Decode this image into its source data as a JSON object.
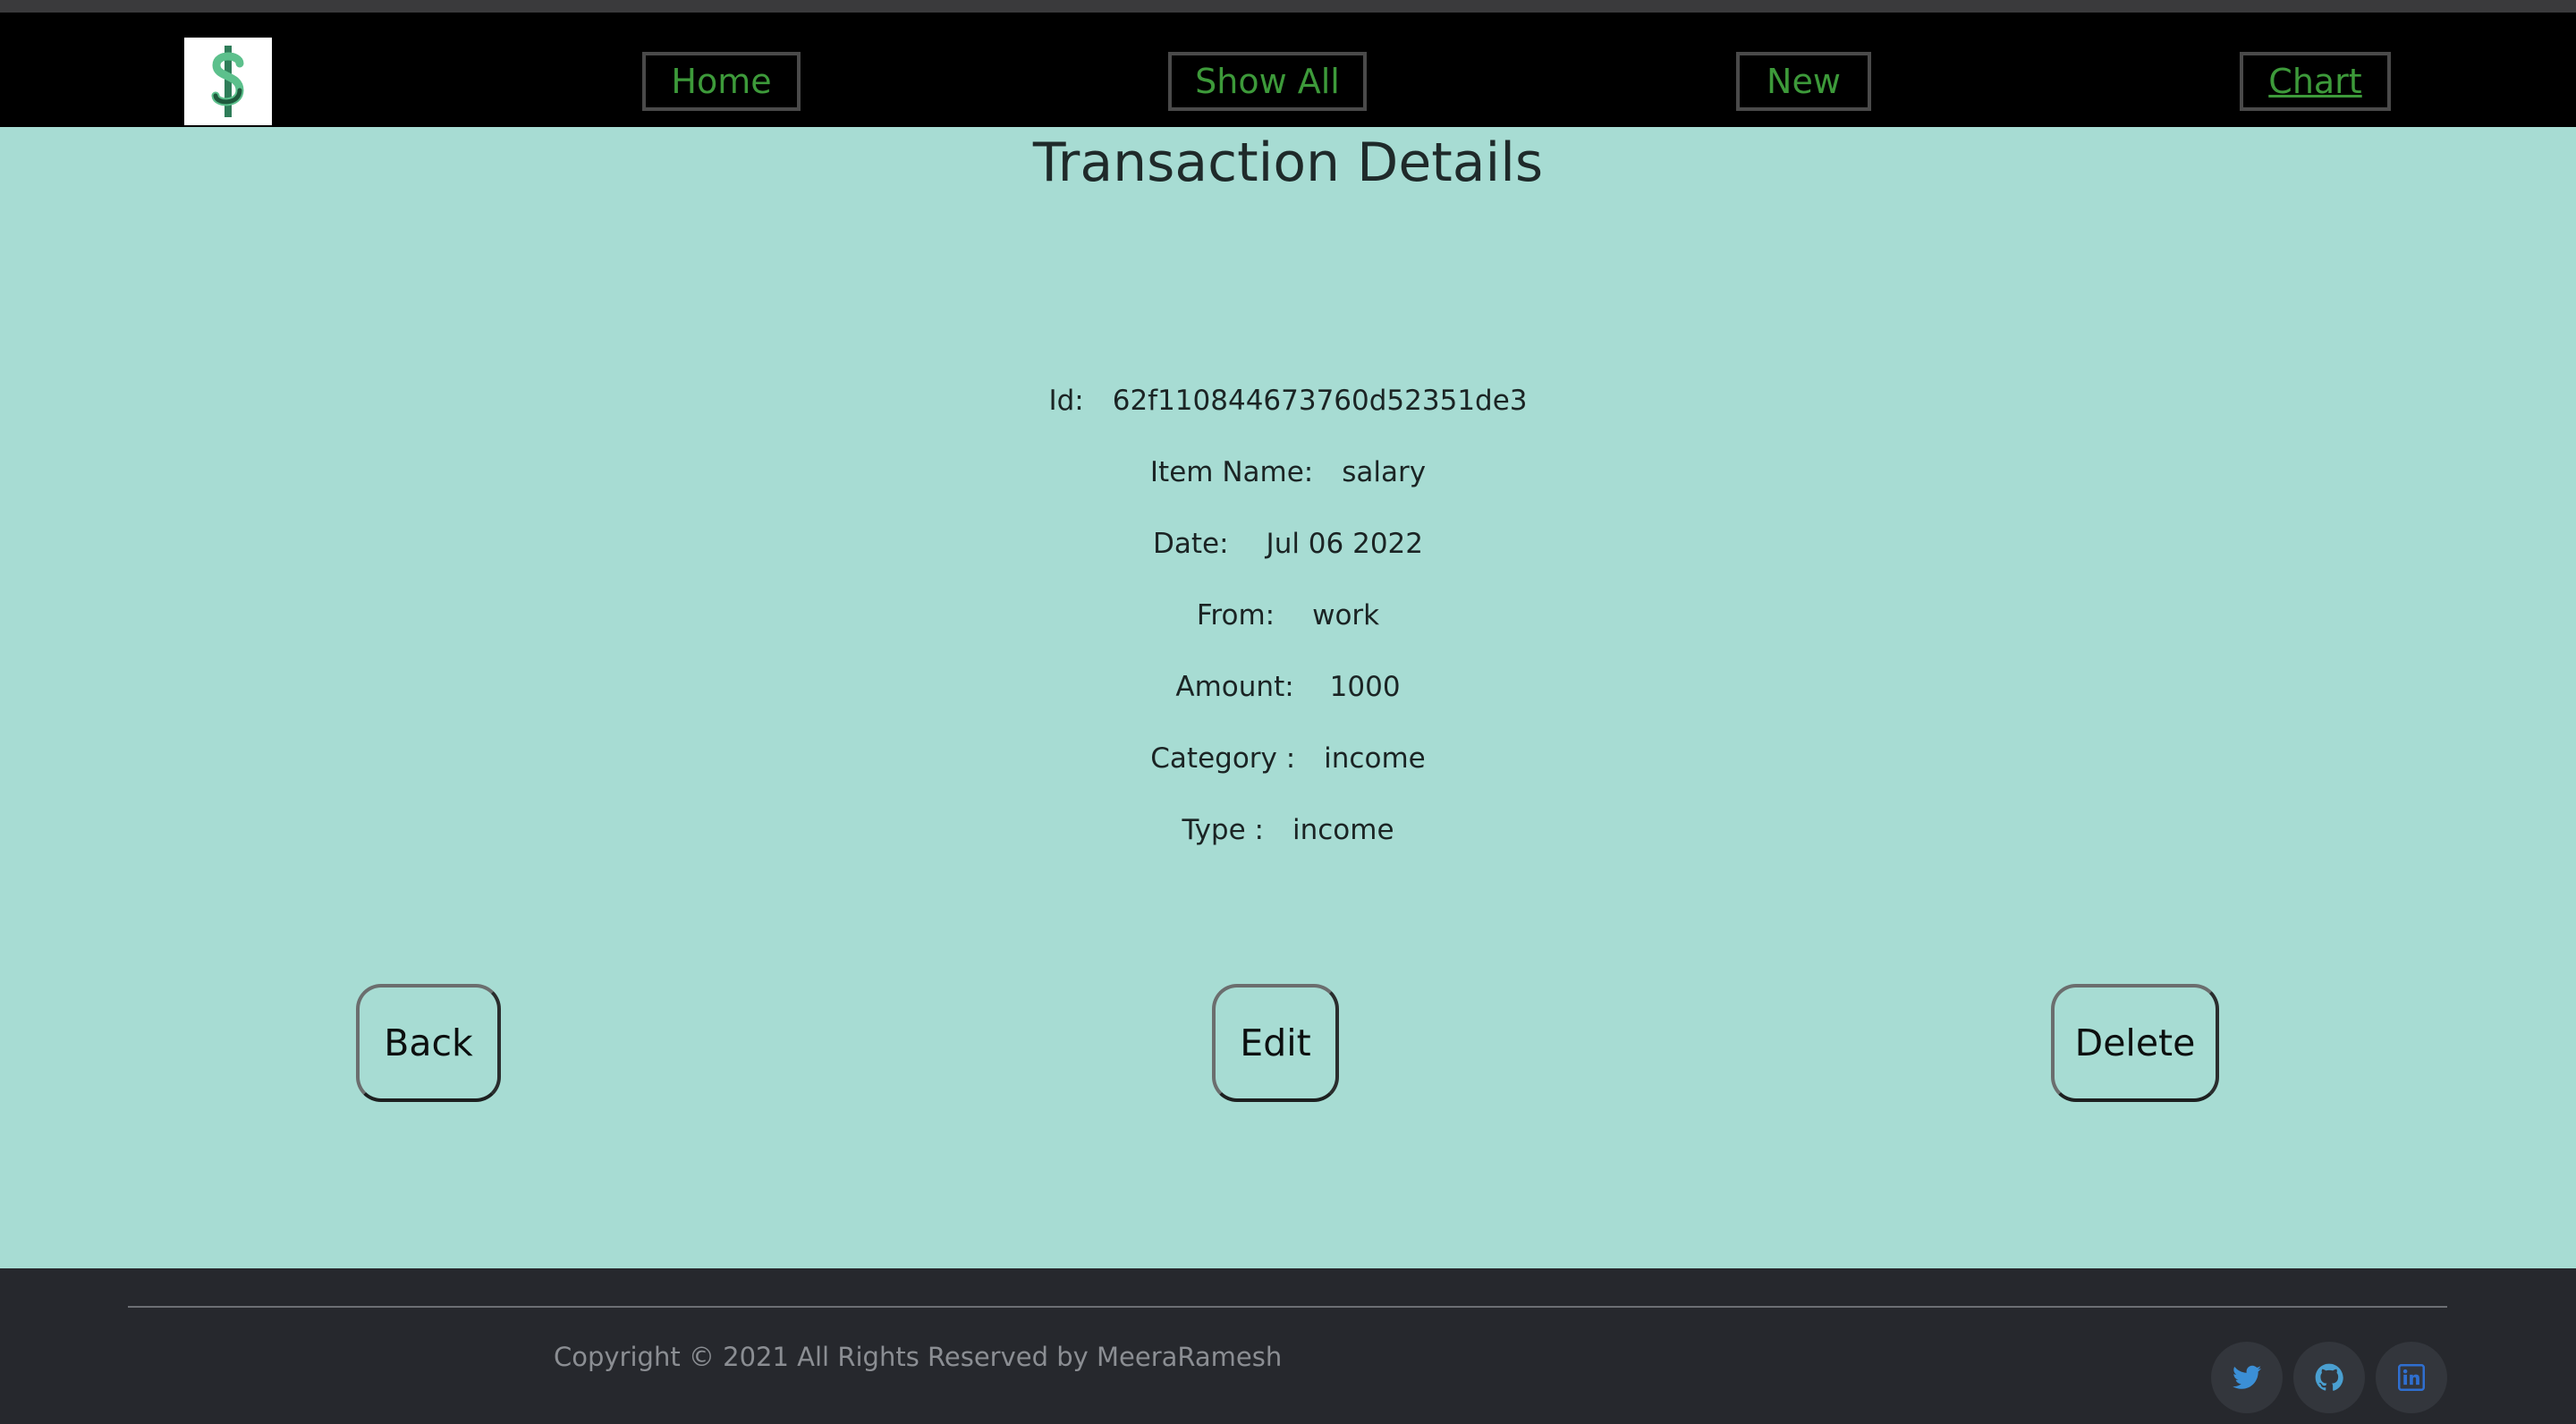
{
  "nav": {
    "logo_icon": "dollar-sign-icon",
    "home": "Home",
    "show_all": "Show All",
    "new": "New",
    "chart": "Chart"
  },
  "page": {
    "title": "Transaction Details"
  },
  "details": [
    {
      "label": "Id:",
      "value": "62f110844673760d52351de3"
    },
    {
      "label": "Item Name:",
      "value": "salary"
    },
    {
      "label": "Date:",
      "value": "Jul 06 2022"
    },
    {
      "label": "From:",
      "value": "work"
    },
    {
      "label": "Amount:",
      "value": "1000"
    },
    {
      "label": "Category :",
      "value": "income"
    },
    {
      "label": "Type :",
      "value": "income"
    }
  ],
  "actions": {
    "back": "Back",
    "edit": "Edit",
    "delete": "Delete"
  },
  "footer": {
    "copyright": "Copyright © 2021 All Rights Reserved by MeeraRamesh",
    "social_icons": [
      "twitter-icon",
      "github-icon",
      "linkedin-icon"
    ]
  },
  "colors": {
    "page_bg": "#a7dcd3",
    "navbar_bg": "#000000",
    "nav_text": "#3d9a3a",
    "footer_bg": "#26282d"
  }
}
